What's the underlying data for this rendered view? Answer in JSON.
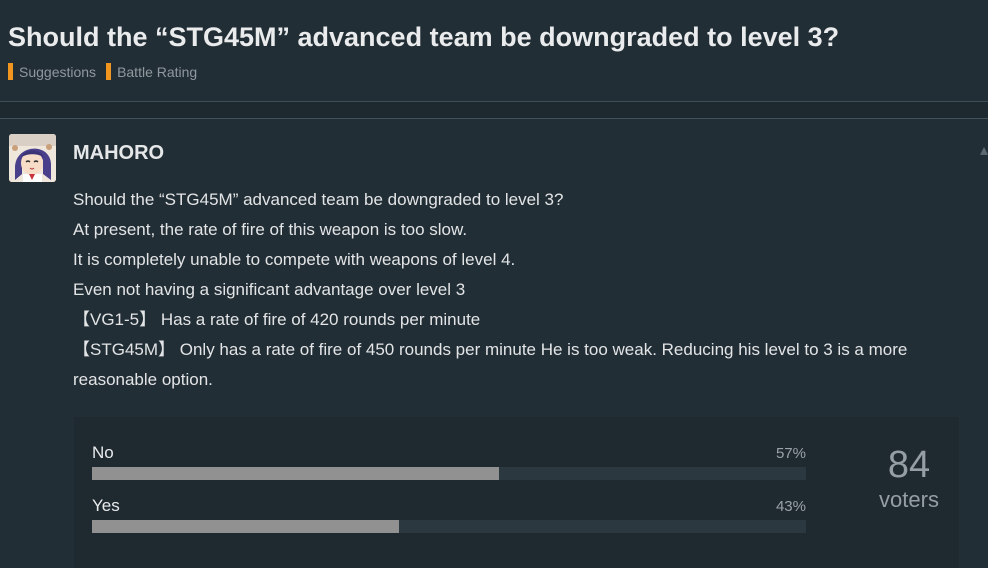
{
  "topic": {
    "title": "Should the “STG45M” advanced team be downgraded to level 3?",
    "tags": [
      {
        "label": "Suggestions",
        "color": "#f0961e"
      },
      {
        "label": "Battle Rating",
        "color": "#f0961e"
      }
    ]
  },
  "post": {
    "username": "MAHORO",
    "avatar_icon": "user-avatar",
    "lines": [
      "Should the “STG45M” advanced team be downgraded to level 3?",
      "At present, the rate of fire of this weapon is too slow.",
      "It is completely unable to compete with weapons of level 4.",
      "Even not having a significant advantage over level 3",
      "【VG1-5】 Has a rate of fire of 420 rounds per minute",
      "【STG45M】 Only has a rate of fire of 450 rounds per minute He is too weak. Reducing his level to 3 is a more reasonable option."
    ]
  },
  "poll": {
    "options": [
      {
        "label": "No",
        "percent_text": "57%",
        "percent": 57
      },
      {
        "label": "Yes",
        "percent_text": "43%",
        "percent": 43
      }
    ],
    "voters_count": "84",
    "voters_label": "voters",
    "bar_color": "#919191"
  }
}
